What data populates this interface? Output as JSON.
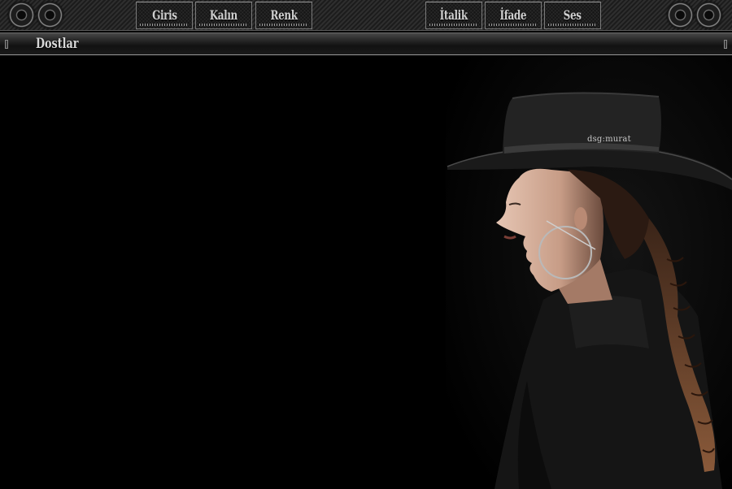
{
  "toolbar": {
    "left_buttons": [
      {
        "label": "Giris"
      },
      {
        "label": "Kalın"
      },
      {
        "label": "Renk"
      }
    ],
    "right_buttons": [
      {
        "label": "İtalik"
      },
      {
        "label": "İfade"
      },
      {
        "label": "Ses"
      }
    ],
    "speaker_icon": "speaker-icon"
  },
  "friends_bar": {
    "label": "Dostlar"
  },
  "background": {
    "signature": "dsg:murat",
    "colors": {
      "page": "#000000",
      "text": "#cfcfcf"
    }
  }
}
